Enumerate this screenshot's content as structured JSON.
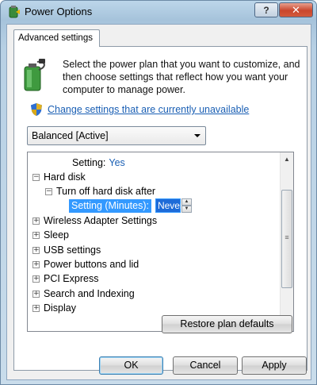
{
  "window": {
    "title": "Power Options"
  },
  "titlebar": {
    "help_label": "?",
    "close_label": "✕"
  },
  "tabs": [
    {
      "label": "Advanced settings"
    }
  ],
  "intro": {
    "description": "Select the power plan that you want to customize, and then choose settings that reflect how you want your computer to manage power.",
    "change_link": "Change settings that are currently unavailable"
  },
  "plan_dropdown": {
    "selected": "Balanced [Active]"
  },
  "tree": {
    "top_setting": {
      "label": "Setting:",
      "value": "Yes"
    },
    "hard_disk": {
      "label": "Hard disk",
      "expander": "−"
    },
    "turn_off": {
      "label": "Turn off hard disk after",
      "expander": "−"
    },
    "minutes_setting": {
      "label": "Setting (Minutes):",
      "value": "Never"
    },
    "items": [
      {
        "label": "Wireless Adapter Settings",
        "expander": "+"
      },
      {
        "label": "Sleep",
        "expander": "+"
      },
      {
        "label": "USB settings",
        "expander": "+"
      },
      {
        "label": "Power buttons and lid",
        "expander": "+"
      },
      {
        "label": "PCI Express",
        "expander": "+"
      },
      {
        "label": "Search and Indexing",
        "expander": "+"
      },
      {
        "label": "Display",
        "expander": "+"
      }
    ]
  },
  "buttons": {
    "restore": "Restore plan defaults",
    "ok": "OK",
    "cancel": "Cancel",
    "apply": "Apply"
  },
  "colors": {
    "link": "#1a5fb4",
    "selection": "#3399ff",
    "close_button": "#c9462c"
  },
  "icons": [
    "power-options-icon",
    "battery-plug-icon",
    "uac-shield-icon",
    "chevron-down-icon",
    "scroll-up-icon",
    "scroll-down-icon"
  ]
}
